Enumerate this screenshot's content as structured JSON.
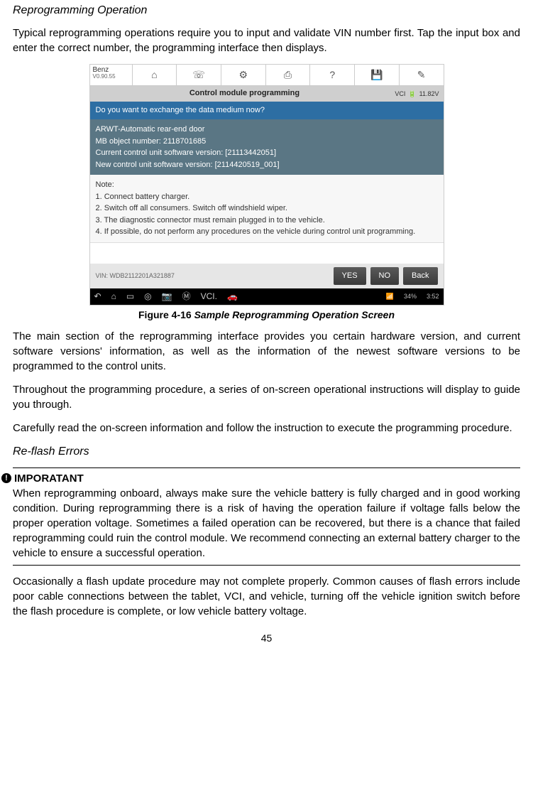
{
  "heading1": "Reprogramming Operation",
  "para1": "Typical reprogramming operations require you to input and validate VIN number first. Tap the input box and enter the correct number, the programming interface then displays.",
  "figure": {
    "caption_prefix": "Figure 4-16 ",
    "caption_title": "Sample Reprogramming Operation Screen",
    "brand": "Benz",
    "version": "V0.90.55",
    "toolbar_icons": [
      "home-icon",
      "phone-icon",
      "gear-icon",
      "print-icon",
      "help-icon",
      "save-icon",
      "edit-icon"
    ],
    "titlebar_title": "Control module programming",
    "titlebar_vci": "VCI",
    "titlebar_batt": "11.82V",
    "prompt": "Do you want to exchange the data medium now?",
    "info_lines": [
      "ARWT-Automatic rear-end door",
      "MB object number: 2118701685",
      "Current control unit software version: [21113442051]",
      "New control unit software version: [2114420519_001]"
    ],
    "note_lines": [
      "Note:",
      "1. Connect battery charger.",
      "2. Switch off all consumers. Switch off windshield wiper.",
      "3. The diagnostic connector must remain plugged in to the vehicle.",
      "4. If possible, do not perform any procedures on the vehicle during control unit programming."
    ],
    "vin": "VIN: WDB2112201A321887",
    "btn_yes": "YES",
    "btn_no": "NO",
    "btn_back": "Back",
    "sysbar_icons": [
      "back-icon",
      "home-sys-icon",
      "recent-icon",
      "screenshot-icon",
      "camera-icon",
      "maxi-icon",
      "vci-icon",
      "car-icon"
    ],
    "sys_batt": "34%",
    "sys_time": "3:52"
  },
  "para2": "The main section of the reprogramming interface provides you certain hardware version, and current software versions' information, as well as the information of the newest software versions to be programmed to the control units.",
  "para3": "Throughout the programming procedure, a series of on-screen operational instructions will display to guide you through.",
  "para4": "Carefully read the on-screen information and follow the instruction to execute the programming procedure.",
  "heading2": "Re-flash Errors",
  "important_head": "IMPORATANT",
  "important_text": "When reprogramming onboard, always make sure the vehicle battery is fully charged and in good working condition. During reprogramming there is a risk of having the operation failure if voltage falls below the proper operation voltage. Sometimes a failed operation can be recovered, but there is a chance that failed reprogramming could ruin the control module. We recommend connecting an external battery charger to the vehicle to ensure a successful operation.",
  "para5": "Occasionally a flash update procedure may not complete properly. Common causes of flash errors include poor cable connections between the tablet, VCI, and vehicle, turning off the vehicle ignition switch before the flash procedure is complete, or low vehicle battery voltage.",
  "page_number": "45"
}
